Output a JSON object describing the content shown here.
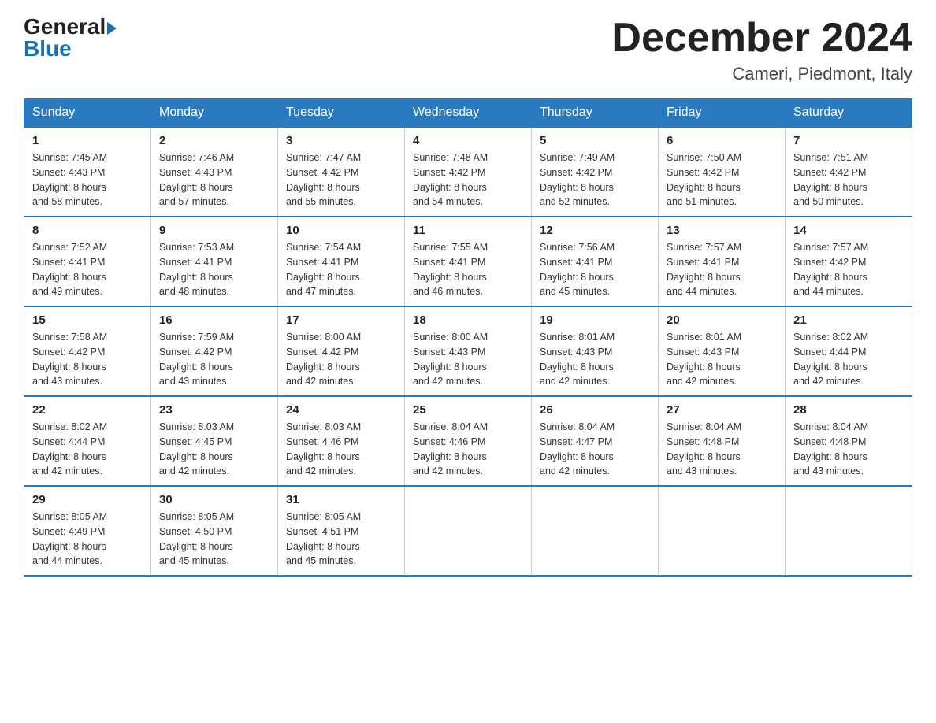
{
  "logo": {
    "general": "General",
    "blue": "Blue",
    "triangle": "▶"
  },
  "header": {
    "title": "December 2024",
    "subtitle": "Cameri, Piedmont, Italy"
  },
  "weekdays": [
    "Sunday",
    "Monday",
    "Tuesday",
    "Wednesday",
    "Thursday",
    "Friday",
    "Saturday"
  ],
  "weeks": [
    [
      {
        "day": "1",
        "sunrise": "7:45 AM",
        "sunset": "4:43 PM",
        "daylight": "8 hours and 58 minutes."
      },
      {
        "day": "2",
        "sunrise": "7:46 AM",
        "sunset": "4:43 PM",
        "daylight": "8 hours and 57 minutes."
      },
      {
        "day": "3",
        "sunrise": "7:47 AM",
        "sunset": "4:42 PM",
        "daylight": "8 hours and 55 minutes."
      },
      {
        "day": "4",
        "sunrise": "7:48 AM",
        "sunset": "4:42 PM",
        "daylight": "8 hours and 54 minutes."
      },
      {
        "day": "5",
        "sunrise": "7:49 AM",
        "sunset": "4:42 PM",
        "daylight": "8 hours and 52 minutes."
      },
      {
        "day": "6",
        "sunrise": "7:50 AM",
        "sunset": "4:42 PM",
        "daylight": "8 hours and 51 minutes."
      },
      {
        "day": "7",
        "sunrise": "7:51 AM",
        "sunset": "4:42 PM",
        "daylight": "8 hours and 50 minutes."
      }
    ],
    [
      {
        "day": "8",
        "sunrise": "7:52 AM",
        "sunset": "4:41 PM",
        "daylight": "8 hours and 49 minutes."
      },
      {
        "day": "9",
        "sunrise": "7:53 AM",
        "sunset": "4:41 PM",
        "daylight": "8 hours and 48 minutes."
      },
      {
        "day": "10",
        "sunrise": "7:54 AM",
        "sunset": "4:41 PM",
        "daylight": "8 hours and 47 minutes."
      },
      {
        "day": "11",
        "sunrise": "7:55 AM",
        "sunset": "4:41 PM",
        "daylight": "8 hours and 46 minutes."
      },
      {
        "day": "12",
        "sunrise": "7:56 AM",
        "sunset": "4:41 PM",
        "daylight": "8 hours and 45 minutes."
      },
      {
        "day": "13",
        "sunrise": "7:57 AM",
        "sunset": "4:41 PM",
        "daylight": "8 hours and 44 minutes."
      },
      {
        "day": "14",
        "sunrise": "7:57 AM",
        "sunset": "4:42 PM",
        "daylight": "8 hours and 44 minutes."
      }
    ],
    [
      {
        "day": "15",
        "sunrise": "7:58 AM",
        "sunset": "4:42 PM",
        "daylight": "8 hours and 43 minutes."
      },
      {
        "day": "16",
        "sunrise": "7:59 AM",
        "sunset": "4:42 PM",
        "daylight": "8 hours and 43 minutes."
      },
      {
        "day": "17",
        "sunrise": "8:00 AM",
        "sunset": "4:42 PM",
        "daylight": "8 hours and 42 minutes."
      },
      {
        "day": "18",
        "sunrise": "8:00 AM",
        "sunset": "4:43 PM",
        "daylight": "8 hours and 42 minutes."
      },
      {
        "day": "19",
        "sunrise": "8:01 AM",
        "sunset": "4:43 PM",
        "daylight": "8 hours and 42 minutes."
      },
      {
        "day": "20",
        "sunrise": "8:01 AM",
        "sunset": "4:43 PM",
        "daylight": "8 hours and 42 minutes."
      },
      {
        "day": "21",
        "sunrise": "8:02 AM",
        "sunset": "4:44 PM",
        "daylight": "8 hours and 42 minutes."
      }
    ],
    [
      {
        "day": "22",
        "sunrise": "8:02 AM",
        "sunset": "4:44 PM",
        "daylight": "8 hours and 42 minutes."
      },
      {
        "day": "23",
        "sunrise": "8:03 AM",
        "sunset": "4:45 PM",
        "daylight": "8 hours and 42 minutes."
      },
      {
        "day": "24",
        "sunrise": "8:03 AM",
        "sunset": "4:46 PM",
        "daylight": "8 hours and 42 minutes."
      },
      {
        "day": "25",
        "sunrise": "8:04 AM",
        "sunset": "4:46 PM",
        "daylight": "8 hours and 42 minutes."
      },
      {
        "day": "26",
        "sunrise": "8:04 AM",
        "sunset": "4:47 PM",
        "daylight": "8 hours and 42 minutes."
      },
      {
        "day": "27",
        "sunrise": "8:04 AM",
        "sunset": "4:48 PM",
        "daylight": "8 hours and 43 minutes."
      },
      {
        "day": "28",
        "sunrise": "8:04 AM",
        "sunset": "4:48 PM",
        "daylight": "8 hours and 43 minutes."
      }
    ],
    [
      {
        "day": "29",
        "sunrise": "8:05 AM",
        "sunset": "4:49 PM",
        "daylight": "8 hours and 44 minutes."
      },
      {
        "day": "30",
        "sunrise": "8:05 AM",
        "sunset": "4:50 PM",
        "daylight": "8 hours and 45 minutes."
      },
      {
        "day": "31",
        "sunrise": "8:05 AM",
        "sunset": "4:51 PM",
        "daylight": "8 hours and 45 minutes."
      },
      null,
      null,
      null,
      null
    ]
  ]
}
